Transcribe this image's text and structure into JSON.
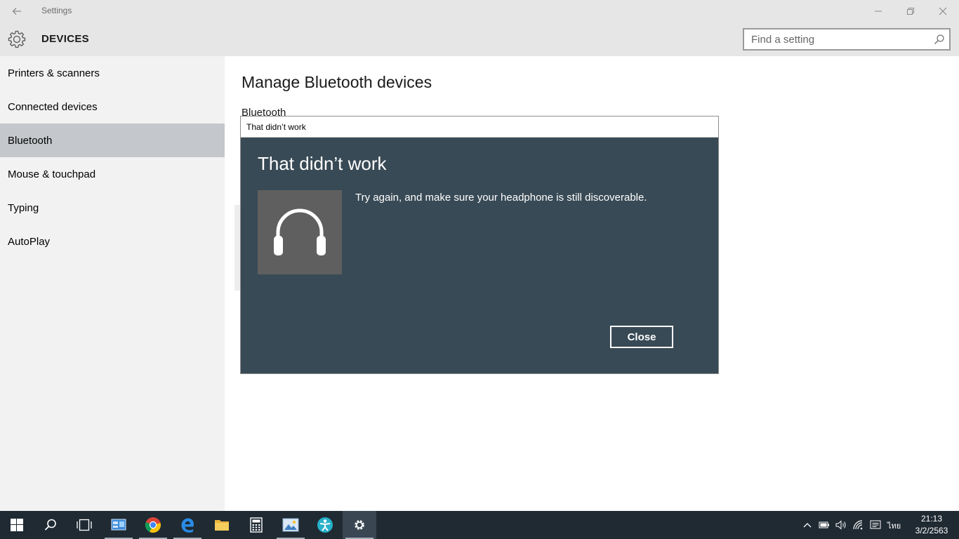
{
  "window": {
    "title": "Settings",
    "icons": {
      "back": "back-arrow-icon",
      "minimize": "minimize-icon",
      "restore": "restore-icon",
      "close": "close-icon"
    }
  },
  "header": {
    "icon": "gear-icon",
    "heading": "DEVICES",
    "search": {
      "placeholder": "Find a setting",
      "value": "",
      "icon": "search-icon"
    }
  },
  "sidebar": {
    "items": [
      {
        "label": "Printers & scanners",
        "active": false
      },
      {
        "label": "Connected devices",
        "active": false
      },
      {
        "label": "Bluetooth",
        "active": true
      },
      {
        "label": "Mouse & touchpad",
        "active": false
      },
      {
        "label": "Typing",
        "active": false
      },
      {
        "label": "AutoPlay",
        "active": false
      }
    ]
  },
  "main": {
    "title": "Manage Bluetooth devices",
    "subtitle": "Bluetooth"
  },
  "dialog": {
    "window_title": "That didn’t work",
    "heading": "That didn’t work",
    "message": "Try again, and make sure your headphone is still discoverable.",
    "device_icon": "headphones-icon",
    "close_label": "Close",
    "colors": {
      "background": "#384a55",
      "tile": "#5f5f5f"
    }
  },
  "taskbar": {
    "apps": [
      {
        "name": "start",
        "icon": "windows-start-icon"
      },
      {
        "name": "search",
        "icon": "search-icon"
      },
      {
        "name": "task-view",
        "icon": "task-view-icon"
      },
      {
        "name": "control-panel",
        "icon": "control-panel-icon"
      },
      {
        "name": "chrome",
        "icon": "chrome-icon"
      },
      {
        "name": "edge",
        "icon": "edge-icon"
      },
      {
        "name": "file-explorer",
        "icon": "folder-icon"
      },
      {
        "name": "calculator",
        "icon": "calculator-icon"
      },
      {
        "name": "photos",
        "icon": "photos-icon"
      },
      {
        "name": "app",
        "icon": "person-app-icon"
      },
      {
        "name": "settings",
        "icon": "gear-icon"
      }
    ],
    "tray": {
      "icons": [
        "chevron-up-icon",
        "battery-icon",
        "volume-icon",
        "wifi-icon",
        "notifications-icon"
      ],
      "language": "ไทย",
      "time": "21:13",
      "date": "3/2/2563"
    }
  }
}
